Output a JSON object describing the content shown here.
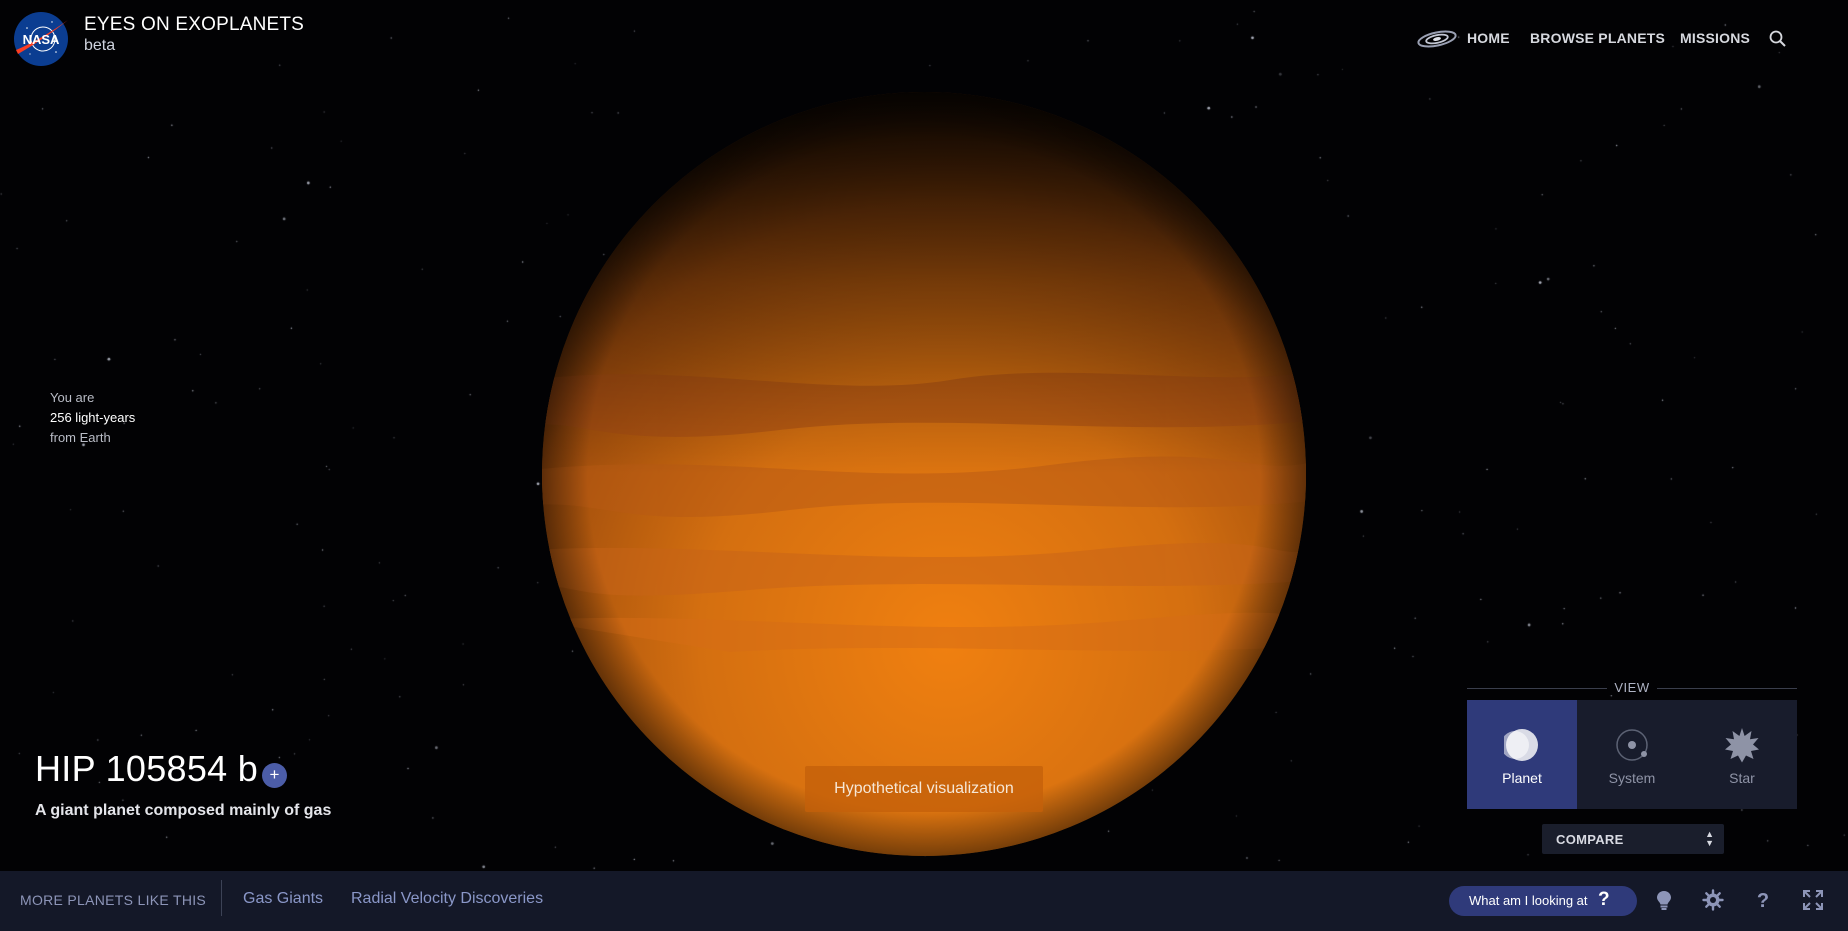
{
  "header": {
    "logo": "NASA",
    "logo_icon": "nasa-meatball-logo",
    "title": "EYES ON EXOPLANETS",
    "subtitle": "beta"
  },
  "nav": {
    "galaxy_icon": "galaxy-icon",
    "home": "HOME",
    "browse": "BROWSE PLANETS",
    "missions": "MISSIONS",
    "search_icon": "search-icon"
  },
  "distance": {
    "line1": "You are",
    "line2": "256 light-years",
    "line3": "from Earth"
  },
  "planet": {
    "name": "HIP 105854 b",
    "add_label": "+",
    "description": "A giant planet composed mainly of gas",
    "badge": "Hypothetical visualization",
    "color": "#d5720f"
  },
  "view": {
    "label": "VIEW",
    "options": [
      {
        "label": "Planet",
        "icon": "planet-icon",
        "active": true
      },
      {
        "label": "System",
        "icon": "system-icon",
        "active": false
      },
      {
        "label": "Star",
        "icon": "star-icon",
        "active": false
      }
    ],
    "compare_label": "COMPARE"
  },
  "bottom_bar": {
    "more_label": "MORE PLANETS LIKE THIS",
    "categories": [
      "Gas Giants",
      "Radial Velocity Discoveries"
    ],
    "help_button": "What am I looking at",
    "help_glyph": "?",
    "icons": [
      "lightbulb-icon",
      "settings-icon",
      "help-icon",
      "fullscreen-icon"
    ]
  },
  "colors": {
    "accent": "#2f3a7a",
    "bar_background": "#141828",
    "link": "#8a97c8"
  }
}
